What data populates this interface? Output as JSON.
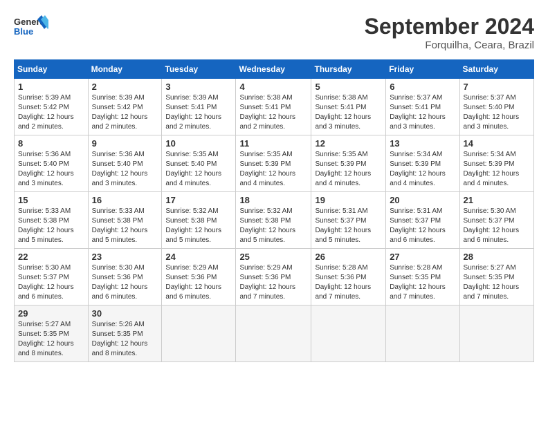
{
  "logo": {
    "line1": "General",
    "line2": "Blue"
  },
  "title": "September 2024",
  "location": "Forquilha, Ceara, Brazil",
  "days_of_week": [
    "Sunday",
    "Monday",
    "Tuesday",
    "Wednesday",
    "Thursday",
    "Friday",
    "Saturday"
  ],
  "weeks": [
    [
      {
        "day": "1",
        "sunrise": "5:39 AM",
        "sunset": "5:42 PM",
        "daylight": "12 hours and 2 minutes."
      },
      {
        "day": "2",
        "sunrise": "5:39 AM",
        "sunset": "5:42 PM",
        "daylight": "12 hours and 2 minutes."
      },
      {
        "day": "3",
        "sunrise": "5:39 AM",
        "sunset": "5:41 PM",
        "daylight": "12 hours and 2 minutes."
      },
      {
        "day": "4",
        "sunrise": "5:38 AM",
        "sunset": "5:41 PM",
        "daylight": "12 hours and 2 minutes."
      },
      {
        "day": "5",
        "sunrise": "5:38 AM",
        "sunset": "5:41 PM",
        "daylight": "12 hours and 3 minutes."
      },
      {
        "day": "6",
        "sunrise": "5:37 AM",
        "sunset": "5:41 PM",
        "daylight": "12 hours and 3 minutes."
      },
      {
        "day": "7",
        "sunrise": "5:37 AM",
        "sunset": "5:40 PM",
        "daylight": "12 hours and 3 minutes."
      }
    ],
    [
      {
        "day": "8",
        "sunrise": "5:36 AM",
        "sunset": "5:40 PM",
        "daylight": "12 hours and 3 minutes."
      },
      {
        "day": "9",
        "sunrise": "5:36 AM",
        "sunset": "5:40 PM",
        "daylight": "12 hours and 3 minutes."
      },
      {
        "day": "10",
        "sunrise": "5:35 AM",
        "sunset": "5:40 PM",
        "daylight": "12 hours and 4 minutes."
      },
      {
        "day": "11",
        "sunrise": "5:35 AM",
        "sunset": "5:39 PM",
        "daylight": "12 hours and 4 minutes."
      },
      {
        "day": "12",
        "sunrise": "5:35 AM",
        "sunset": "5:39 PM",
        "daylight": "12 hours and 4 minutes."
      },
      {
        "day": "13",
        "sunrise": "5:34 AM",
        "sunset": "5:39 PM",
        "daylight": "12 hours and 4 minutes."
      },
      {
        "day": "14",
        "sunrise": "5:34 AM",
        "sunset": "5:39 PM",
        "daylight": "12 hours and 4 minutes."
      }
    ],
    [
      {
        "day": "15",
        "sunrise": "5:33 AM",
        "sunset": "5:38 PM",
        "daylight": "12 hours and 5 minutes."
      },
      {
        "day": "16",
        "sunrise": "5:33 AM",
        "sunset": "5:38 PM",
        "daylight": "12 hours and 5 minutes."
      },
      {
        "day": "17",
        "sunrise": "5:32 AM",
        "sunset": "5:38 PM",
        "daylight": "12 hours and 5 minutes."
      },
      {
        "day": "18",
        "sunrise": "5:32 AM",
        "sunset": "5:38 PM",
        "daylight": "12 hours and 5 minutes."
      },
      {
        "day": "19",
        "sunrise": "5:31 AM",
        "sunset": "5:37 PM",
        "daylight": "12 hours and 5 minutes."
      },
      {
        "day": "20",
        "sunrise": "5:31 AM",
        "sunset": "5:37 PM",
        "daylight": "12 hours and 6 minutes."
      },
      {
        "day": "21",
        "sunrise": "5:30 AM",
        "sunset": "5:37 PM",
        "daylight": "12 hours and 6 minutes."
      }
    ],
    [
      {
        "day": "22",
        "sunrise": "5:30 AM",
        "sunset": "5:37 PM",
        "daylight": "12 hours and 6 minutes."
      },
      {
        "day": "23",
        "sunrise": "5:30 AM",
        "sunset": "5:36 PM",
        "daylight": "12 hours and 6 minutes."
      },
      {
        "day": "24",
        "sunrise": "5:29 AM",
        "sunset": "5:36 PM",
        "daylight": "12 hours and 6 minutes."
      },
      {
        "day": "25",
        "sunrise": "5:29 AM",
        "sunset": "5:36 PM",
        "daylight": "12 hours and 7 minutes."
      },
      {
        "day": "26",
        "sunrise": "5:28 AM",
        "sunset": "5:36 PM",
        "daylight": "12 hours and 7 minutes."
      },
      {
        "day": "27",
        "sunrise": "5:28 AM",
        "sunset": "5:35 PM",
        "daylight": "12 hours and 7 minutes."
      },
      {
        "day": "28",
        "sunrise": "5:27 AM",
        "sunset": "5:35 PM",
        "daylight": "12 hours and 7 minutes."
      }
    ],
    [
      {
        "day": "29",
        "sunrise": "5:27 AM",
        "sunset": "5:35 PM",
        "daylight": "12 hours and 8 minutes."
      },
      {
        "day": "30",
        "sunrise": "5:26 AM",
        "sunset": "5:35 PM",
        "daylight": "12 hours and 8 minutes."
      },
      null,
      null,
      null,
      null,
      null
    ]
  ]
}
